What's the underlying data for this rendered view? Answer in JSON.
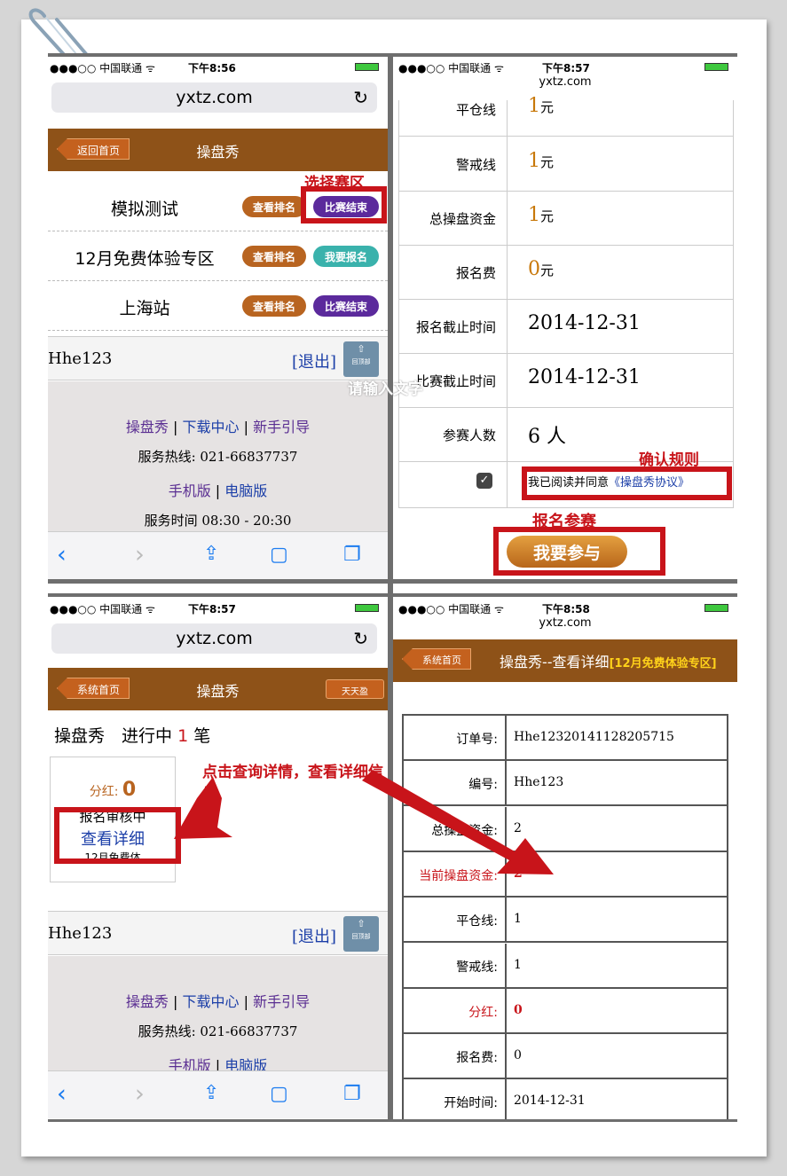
{
  "panels": [
    {
      "carrier": "●●●○○ 中国联通 ᯤ",
      "time": "下午8:56",
      "url": "yxtz.com",
      "back_label": "返回首页",
      "page_title": "操盘秀",
      "view_rank": "查看排名",
      "rows": [
        {
          "name": "模拟测试",
          "status": "比赛结束"
        },
        {
          "name": "12月免费体验专区",
          "status": "我要报名"
        },
        {
          "name": "上海站",
          "status": "比赛结束"
        }
      ],
      "user": "Hhe123",
      "logout": "[退出]",
      "top_label": "回顶部"
    },
    {
      "carrier": "●●●○○ 中国联通 ᯤ",
      "time": "下午8:57",
      "url": "yxtz.com",
      "rows": [
        {
          "label": "平仓线",
          "value": "1",
          "unit": "元"
        },
        {
          "label": "警戒线",
          "value": "1",
          "unit": "元"
        },
        {
          "label": "总操盘资金",
          "value": "1",
          "unit": "元"
        },
        {
          "label": "报名费",
          "value": "0",
          "unit": "元"
        },
        {
          "label": "报名截止时间",
          "value": "2014-12-31",
          "unit": ""
        },
        {
          "label": "比赛截止时间",
          "value": "2014-12-31",
          "unit": ""
        },
        {
          "label": "参赛人数",
          "value": "6 人",
          "unit": ""
        }
      ],
      "agree_text": "我已阅读并同意",
      "agree_link": "《操盘秀协议》",
      "join_btn": "我要参与"
    },
    {
      "carrier": "●●●○○ 中国联通 ᯤ",
      "time": "下午8:57",
      "url": "yxtz.com",
      "back_label": "系统首页",
      "page_title": "操盘秀",
      "right_btn": "天天盈",
      "summary_a": "操盘秀　进行中",
      "summary_count": "1",
      "summary_b": "笔",
      "dividend_label": "分红:",
      "dividend_value": "0",
      "order_status": "报名审核中",
      "view_detail": "查看详细",
      "order_zone": "12月免费体"
    },
    {
      "carrier": "●●●○○ 中国联通 ᯤ",
      "time": "下午8:58",
      "url": "yxtz.com",
      "back_label": "系统首页",
      "page_title": "操盘秀--查看详细",
      "zone_tag": "[12月免费体验专区]",
      "rows": [
        {
          "label": "订单号:",
          "value": "Hhe12320141128205715",
          "hl": false
        },
        {
          "label": "编号:",
          "value": "Hhe123",
          "hl": false
        },
        {
          "label": "总操盘资金:",
          "value": "2",
          "hl": false
        },
        {
          "label": "当前操盘资金:",
          "value": "2",
          "hl": true
        },
        {
          "label": "平仓线:",
          "value": "1",
          "hl": false
        },
        {
          "label": "警戒线:",
          "value": "1",
          "hl": false
        },
        {
          "label": "分红:",
          "value": "0",
          "hl": true
        },
        {
          "label": "报名费:",
          "value": "0",
          "hl": false
        },
        {
          "label": "开始时间:",
          "value": "2014-12-31",
          "hl": false
        }
      ]
    }
  ],
  "footer": {
    "link1": "操盘秀",
    "link2": "下载中心",
    "link3": "新手引导",
    "hotline": "服务热线: 021-66837737",
    "mobile": "手机版",
    "pc": "电脑版",
    "hours": "服务时间 08:30 - 20:30"
  },
  "annotations": {
    "select_zone": "选择赛区",
    "confirm_rules": "确认规则",
    "sign_up": "报名参赛",
    "view_details": "点击查询详情，查看详细信息",
    "watermark": "请输入文字"
  },
  "colors": {
    "header_brown": "#8e5218",
    "annotation_red": "#c8141a",
    "value_orange": "#c8780a",
    "link_blue": "#1c3fa8",
    "link_purple": "#5a2e92"
  }
}
